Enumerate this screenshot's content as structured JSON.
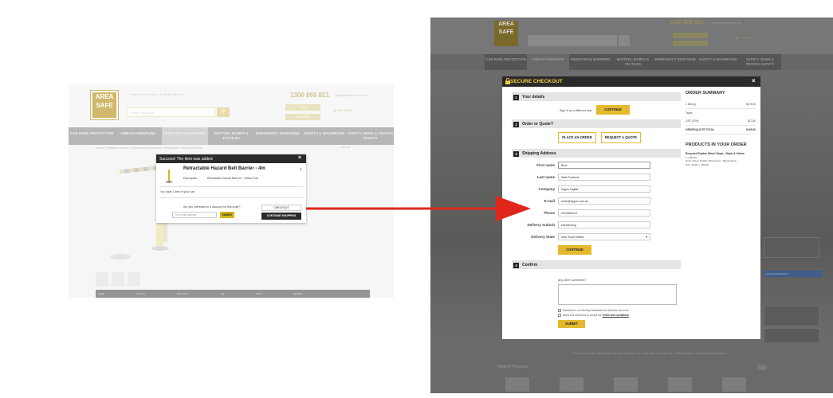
{
  "left_screen": {
    "logo": [
      "AREA",
      "SAFE"
    ],
    "top_links": "Products   Contact Us   Blog   Search",
    "phone": "1300 869 821",
    "email": "sales@areasafe.com.au",
    "search_placeholder": "Search products",
    "account_btn": "LOG IN",
    "register_btn": "REGISTER",
    "cart_label": "MY CART",
    "nav": [
      "CAR PARK PROTECTION",
      "URBAN FURNITURE",
      "PEDESTRIAN BARRIERS",
      "MATTING, RAMPS & TACTILES",
      "EMERGENCY RESPONSE",
      "SAFETY & WASHROOM",
      "SAFETY SIGNS & TRAFFIC SAFETY"
    ],
    "breadcrumb": "Home  /  Pedestrian Barriers  /  Retractable Belt Barriers  /  Retractable Hazard Belt Barrier",
    "table_head": [
      "Image",
      "Product",
      "Description",
      "Qty",
      "Price",
      "Quantity"
    ],
    "popup": {
      "title": "Success! The item was added",
      "close": "×",
      "product_name": "Retractable Hazard Belt Barrier - 4m",
      "qty": "1",
      "desc_label": "Description",
      "desc_value": "Retractable Hazard Belt 4m - Yellow Post",
      "count_text": "You have 1 item in your cart",
      "discount_question": "Are you interested in a discount for this order?",
      "email_placeholder": "Your email address",
      "submit": "SUBMIT",
      "checkout": "CHECKOUT",
      "continue": "CONTINUE SHOPPING"
    }
  },
  "right_screen": {
    "logo": [
      "AREA",
      "SAFE"
    ],
    "phone": "1300 869 821",
    "email": "sales@areasafe.com.au",
    "cart_label": "MY CART",
    "nav": [
      "CAR PARK PROTECTION",
      "URBAN FURNITURE",
      "PEDESTRIAN BARRIERS",
      "MATTING, RAMPS & TACTILES",
      "EMERGENCY RESPONSE",
      "SAFETY & WASHROOM",
      "SAFETY SIGNS & TRAFFIC SAFETY"
    ],
    "side_feature": "Level access/Hazard",
    "footer_note": "Need to buy online and confirming your discount? Go to the shop or contact us: 1300 869 821 or sales@areasafe.com.au",
    "related_title": "Related Products",
    "related_nav": "< >",
    "checkout": {
      "title": "SECURE CHECKOUT",
      "close": "×",
      "sec1_num": "1",
      "sec1": "Your details",
      "sign_in_text": "Sign in as a different user",
      "continue1": "CONTINUE",
      "sec2_num": "2",
      "sec2": "Order or Quote?",
      "place_order": "PLACE AN ORDER",
      "request_quote": "REQUEST A QUOTE",
      "sec3_num": "3",
      "sec3": "Shipping Address",
      "fields": [
        {
          "label": "First name",
          "value": "Bree"
        },
        {
          "label": "Last name",
          "value": "Safe Products"
        },
        {
          "label": "Company",
          "value": "Sygon Digital"
        },
        {
          "label": "E-mail",
          "value": "mark@sygon.com.au"
        },
        {
          "label": "Phone",
          "value": "0419869513"
        },
        {
          "label": "Delivery Suburb",
          "value": "Dandenong"
        },
        {
          "label": "Delivery State",
          "value": "New South Wales"
        }
      ],
      "continue2": "CONTINUE",
      "sec4_num": "4",
      "sec4": "Confirm",
      "comments_label": "Any other comments?",
      "newsletter": "Subscribe to our Monthly Newsletter for Specials and more",
      "terms_prefix": "Select this check box to accept the",
      "terms_link": "Terms and Conditions",
      "submit": "SUBMIT"
    },
    "summary": {
      "title": "ORDER SUMMARY",
      "rows": [
        {
          "label": "1 item(s)",
          "value": "$178.00"
        },
        {
          "label": "Taxes",
          "value": ""
        },
        {
          "label": "GST (10%)",
          "value": "$17.80"
        },
        {
          "label": "ORDER/QUOTE TOTAL",
          "value": "$195.50"
        }
      ],
      "products_title": "PRODUCTS IN YOUR ORDER",
      "product_name": "Recycled Rubber Wheel Stops - Black & Yellow",
      "product_qty": "1  x  $95.00",
      "product_option": "Rock Option: Rubber Wheel Stop - Black/Yellow",
      "product_size": "Size: 900(L) x 180(W)"
    }
  }
}
